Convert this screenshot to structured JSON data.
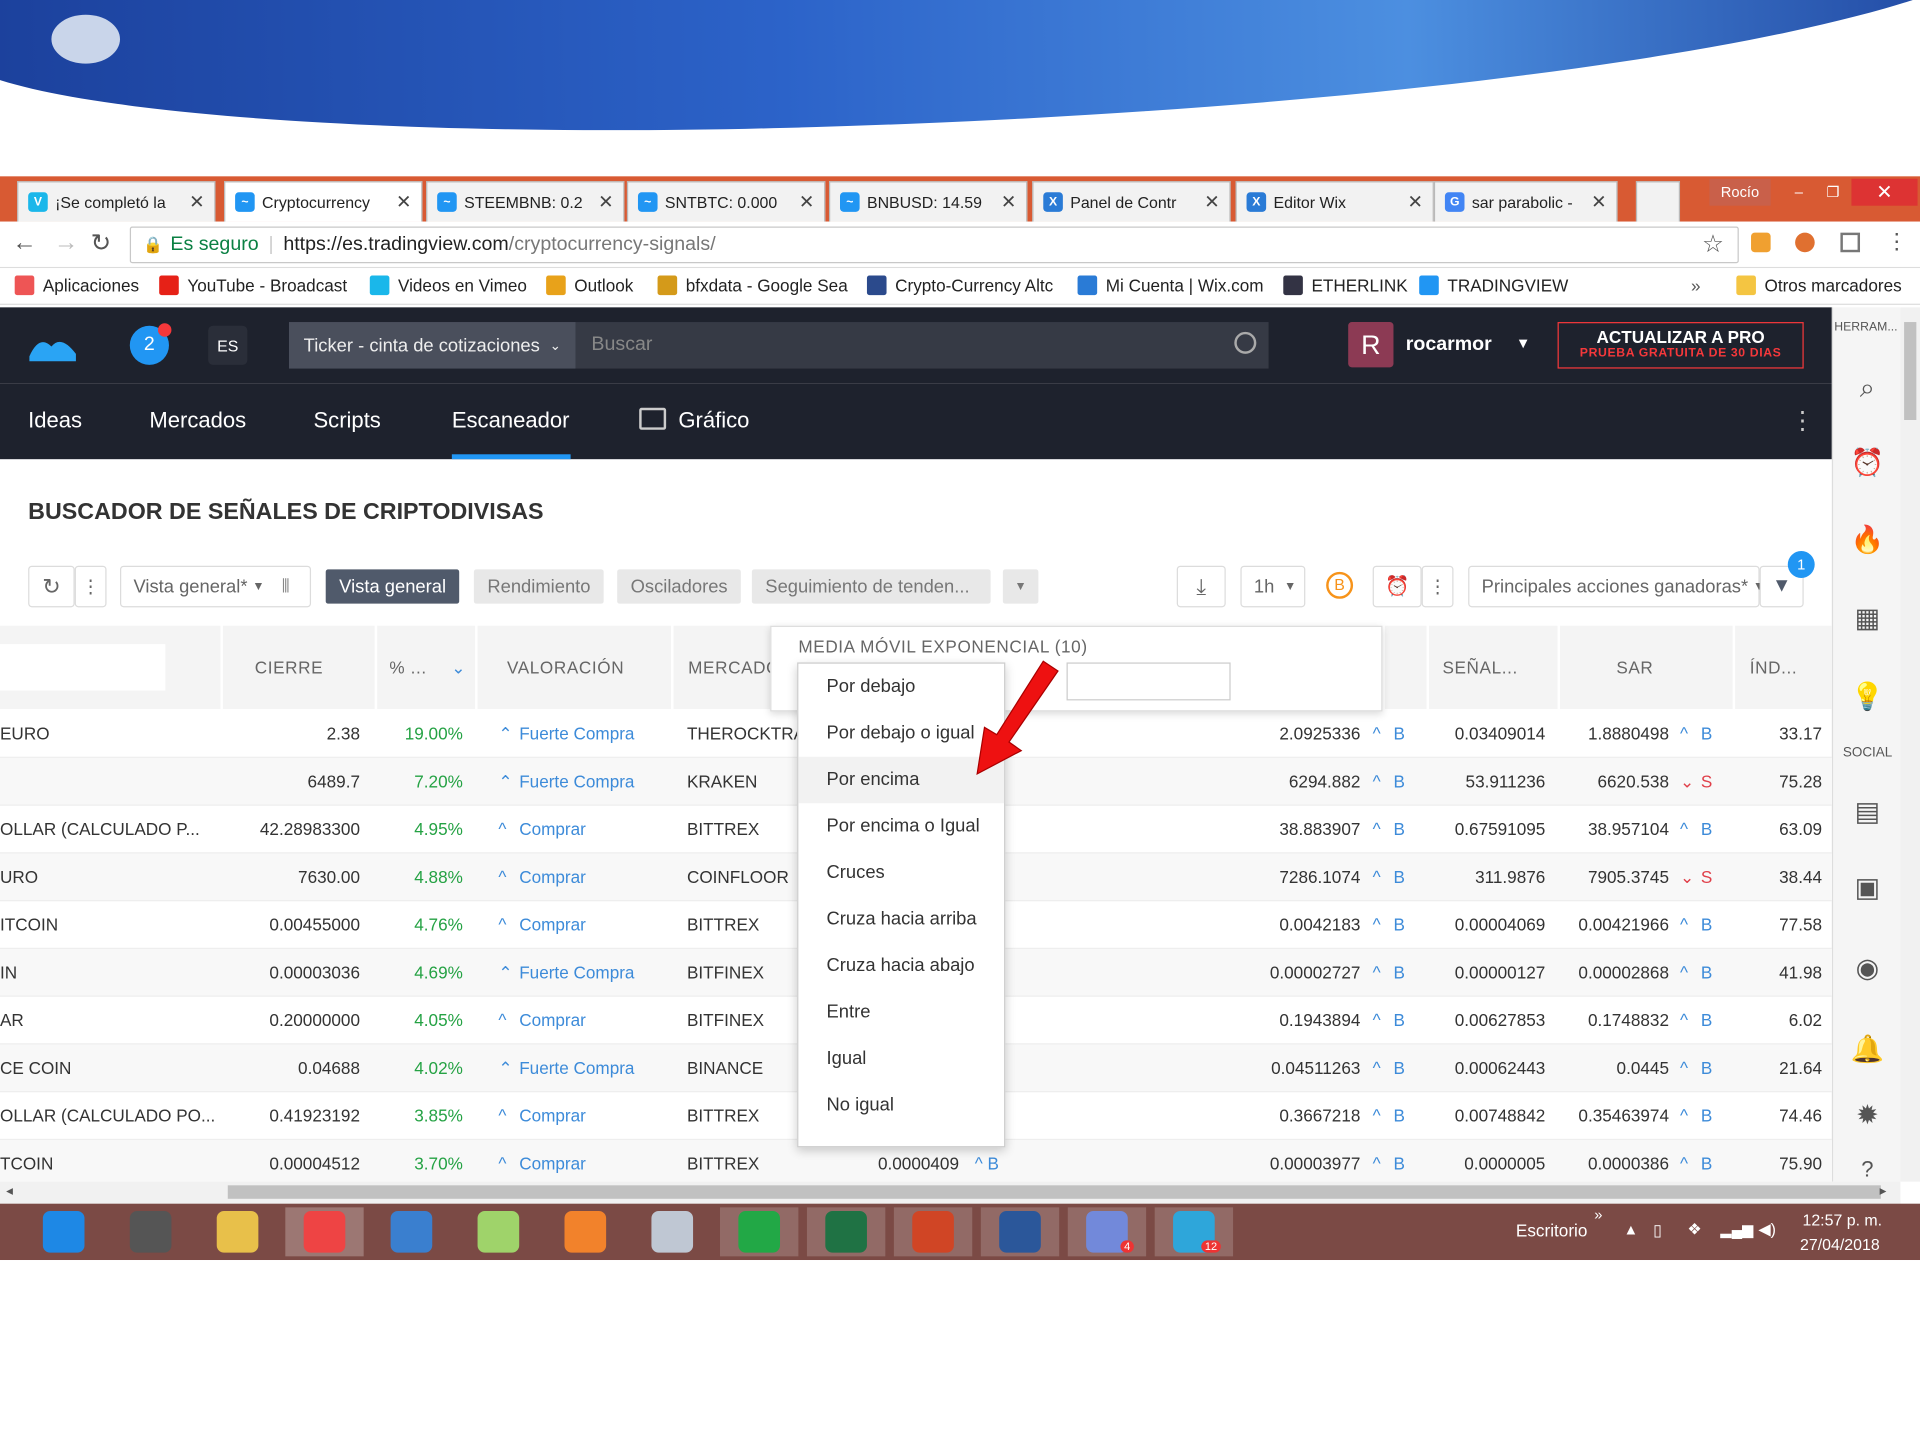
{
  "browser": {
    "tabs": [
      {
        "title": "¡Se completó la",
        "icon": "vimeo-icon",
        "color": "#1ab7ea",
        "glyph": "V"
      },
      {
        "title": "Cryptocurrency",
        "icon": "tradingview-icon",
        "color": "#2196f3",
        "glyph": "~"
      },
      {
        "title": "STEEMBNB: 0.2",
        "icon": "tradingview-icon",
        "color": "#2196f3",
        "glyph": "~"
      },
      {
        "title": "SNTBTC: 0.000",
        "icon": "tradingview-icon",
        "color": "#2196f3",
        "glyph": "~"
      },
      {
        "title": "BNBUSD: 14.59",
        "icon": "tradingview-icon",
        "color": "#2196f3",
        "glyph": "~"
      },
      {
        "title": "Panel de Contr",
        "icon": "wix-icon",
        "color": "#2a7bd6",
        "glyph": "X"
      },
      {
        "title": "Editor Wix",
        "icon": "wix-icon",
        "color": "#2a7bd6",
        "glyph": "X"
      },
      {
        "title": "sar parabolic -",
        "icon": "google-icon",
        "color": "#4285f4",
        "glyph": "G"
      }
    ],
    "user_label": "Rocío",
    "secure_label": "Es seguro",
    "url_host": "https://es.tradingview.com",
    "url_path": "/cryptocurrency-signals/",
    "bookmarks": [
      {
        "label": "Aplicaciones",
        "icon": "apps-icon",
        "color": "#e55"
      },
      {
        "label": "YouTube - Broadcast",
        "icon": "youtube-icon",
        "color": "#e62117"
      },
      {
        "label": "Videos en Vimeo",
        "icon": "vimeo-icon",
        "color": "#1ab7ea"
      },
      {
        "label": "Outlook",
        "icon": "office-icon",
        "color": "#e8a21a"
      },
      {
        "label": "bfxdata - Google Sea",
        "icon": "chart-icon",
        "color": "#d49a1a"
      },
      {
        "label": "Crypto-Currency Altc",
        "icon": "ce-icon",
        "color": "#2b4a8c"
      },
      {
        "label": "Mi Cuenta | Wix.com",
        "icon": "wix-icon",
        "color": "#2a7bd6"
      },
      {
        "label": "ETHERLINK",
        "icon": "diamond-icon",
        "color": "#334"
      },
      {
        "label": "TRADINGVIEW",
        "icon": "tradingview-icon",
        "color": "#2196f3"
      }
    ],
    "bookmarks_more": "»",
    "other_bookmarks": "Otros marcadores"
  },
  "tv": {
    "notif_count": "2",
    "lang": "ES",
    "ticker_dropdown": "Ticker - cinta de cotizaciones",
    "search_placeholder": "Buscar",
    "avatar_letter": "R",
    "username": "rocarmor",
    "upgrade_title": "ACTUALIZAR A PRO",
    "upgrade_sub": "PRUEBA GRATUITA DE 30 DIAS",
    "nav": [
      "Ideas",
      "Mercados",
      "Scripts",
      "Escaneador",
      "Gráfico"
    ],
    "side_title": "HERRAM...",
    "side_social": "SOCIAL"
  },
  "page": {
    "title": "BUSCADOR DE SEÑALES DE CRIPTODIVISAS",
    "view_select": "Vista general*",
    "tabs": [
      "Vista general",
      "Rendimiento",
      "Osciladores",
      "Seguimiento de tenden..."
    ],
    "interval": "1h",
    "preset": "Principales acciones ganadoras*",
    "filter_count": "1",
    "columns": [
      "CIERRE",
      "% ...",
      "VALORACIÓN",
      "MERCADO",
      "SEÑAL...",
      "SAR",
      "ÍND..."
    ],
    "filter_title": "MEDIA MÓVIL EXPONENCIAL (10)"
  },
  "rows": [
    {
      "name": "EURO",
      "close": "2.38",
      "chg": "19.00%",
      "rating": "Fuerte Compra",
      "strong": true,
      "market": "THEROCKTRADING",
      "ema": "",
      "signal": "2.0925336",
      "sig_dir": "B",
      "sar_a": "0.03409014",
      "sar": "1.8880498",
      "sar_dir": "B",
      "idx": "33.17"
    },
    {
      "name": "",
      "close": "6489.7",
      "chg": "7.20%",
      "rating": "Fuerte Compra",
      "strong": true,
      "market": "KRAKEN",
      "ema": "",
      "signal": "6294.882",
      "sig_dir": "B",
      "sar_a": "53.911236",
      "sar": "6620.538",
      "sar_dir": "S",
      "idx": "75.28"
    },
    {
      "name": "OLLAR (CALCULADO P...",
      "close": "42.28983300",
      "chg": "4.95%",
      "rating": "Comprar",
      "strong": false,
      "market": "BITTREX",
      "ema": "",
      "signal": "38.883907",
      "sig_dir": "B",
      "sar_a": "0.67591095",
      "sar": "38.957104",
      "sar_dir": "B",
      "idx": "63.09"
    },
    {
      "name": "URO",
      "close": "7630.00",
      "chg": "4.88%",
      "rating": "Comprar",
      "strong": false,
      "market": "COINFLOOR",
      "ema": "",
      "signal": "7286.1074",
      "sig_dir": "B",
      "sar_a": "311.9876",
      "sar": "7905.3745",
      "sar_dir": "S",
      "idx": "38.44"
    },
    {
      "name": "ITCOIN",
      "close": "0.00455000",
      "chg": "4.76%",
      "rating": "Comprar",
      "strong": false,
      "market": "BITTREX",
      "ema": "",
      "signal": "0.0042183",
      "sig_dir": "B",
      "sar_a": "0.00004069",
      "sar": "0.00421966",
      "sar_dir": "B",
      "idx": "77.58"
    },
    {
      "name": "IN",
      "close": "0.00003036",
      "chg": "4.69%",
      "rating": "Fuerte Compra",
      "strong": true,
      "market": "BITFINEX",
      "ema": "",
      "signal": "0.00002727",
      "sig_dir": "B",
      "sar_a": "0.00000127",
      "sar": "0.00002868",
      "sar_dir": "B",
      "idx": "41.98"
    },
    {
      "name": "AR",
      "close": "0.20000000",
      "chg": "4.05%",
      "rating": "Comprar",
      "strong": false,
      "market": "BITFINEX",
      "ema": "",
      "signal": "0.1943894",
      "sig_dir": "B",
      "sar_a": "0.00627853",
      "sar": "0.1748832",
      "sar_dir": "B",
      "idx": "6.02"
    },
    {
      "name": "CE COIN",
      "close": "0.04688",
      "chg": "4.02%",
      "rating": "Fuerte Compra",
      "strong": true,
      "market": "BINANCE",
      "ema": "",
      "signal": "0.04511263",
      "sig_dir": "B",
      "sar_a": "0.00062443",
      "sar": "0.0445",
      "sar_dir": "B",
      "idx": "21.64"
    },
    {
      "name": "OLLAR (CALCULADO PO...",
      "close": "0.41923192",
      "chg": "3.85%",
      "rating": "Comprar",
      "strong": false,
      "market": "BITTREX",
      "ema": "",
      "signal": "0.3667218",
      "sig_dir": "B",
      "sar_a": "0.00748842",
      "sar": "0.35463974",
      "sar_dir": "B",
      "idx": "74.46"
    },
    {
      "name": "TCOIN",
      "close": "0.00004512",
      "chg": "3.70%",
      "rating": "Comprar",
      "strong": false,
      "market": "BITTREX",
      "ema": "0.0000409",
      "signal": "0.00003977",
      "sig_dir": "B",
      "sar_a": "0.0000005",
      "sar": "0.0000386",
      "sar_dir": "B",
      "idx": "75.90"
    }
  ],
  "menu": [
    "Por debajo",
    "Por debajo o igual",
    "Por encima",
    "Por encima o Igual",
    "Cruces",
    "Cruza hacia arriba",
    "Cruza hacia abajo",
    "Entre",
    "Igual",
    "No igual"
  ],
  "taskbar": {
    "desktop_label": "Escritorio",
    "more": "»",
    "time": "12:57 p. m.",
    "date": "27/04/2018",
    "discord_badge": "4",
    "telegram_badge": "12",
    "apps": [
      {
        "icon": "ie-icon",
        "color": "#1e88e5"
      },
      {
        "icon": "microphone-icon",
        "color": "#555"
      },
      {
        "icon": "file-explorer-icon",
        "color": "#e8c04a"
      },
      {
        "icon": "chrome-icon",
        "color": "#e44"
      },
      {
        "icon": "control-panel-icon",
        "color": "#3a7fcf"
      },
      {
        "icon": "folder-icon",
        "color": "#9fd36a"
      },
      {
        "icon": "media-player-icon",
        "color": "#f2822b"
      },
      {
        "icon": "calculator-icon",
        "color": "#bfc7d3"
      },
      {
        "icon": "whatsapp-icon",
        "color": "#22a846"
      },
      {
        "icon": "excel-icon",
        "color": "#1f7244"
      },
      {
        "icon": "powerpoint-icon",
        "color": "#d04525"
      },
      {
        "icon": "word-icon",
        "color": "#2b579a"
      },
      {
        "icon": "discord-icon",
        "color": "#7289da"
      },
      {
        "icon": "telegram-icon",
        "color": "#2ea6da"
      }
    ]
  }
}
